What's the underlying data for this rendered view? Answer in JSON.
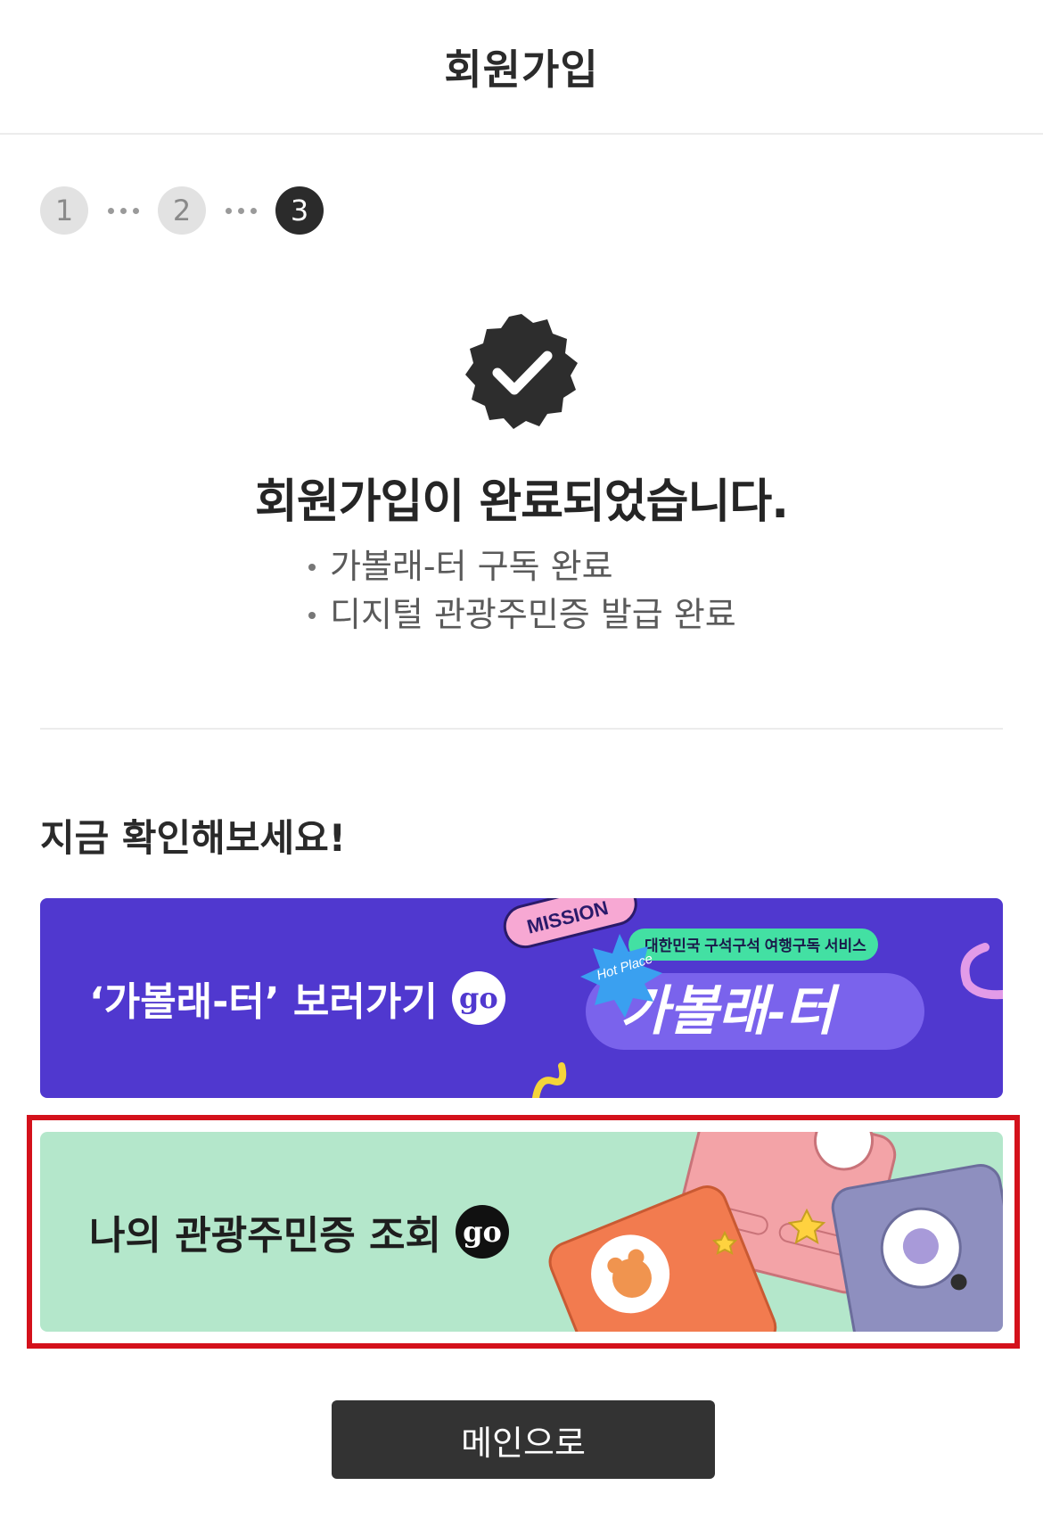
{
  "header": {
    "title": "회원가입"
  },
  "steps": {
    "items": [
      "1",
      "2",
      "3"
    ],
    "current_step": 3
  },
  "completion": {
    "title": "회원가입이 완료되었습니다.",
    "bullets": [
      "가볼래-터 구독 완료",
      "디지털 관광주민증 발급 완료"
    ],
    "icon": "verified-check-badge-icon"
  },
  "section": {
    "title": "지금 확인해보세요!"
  },
  "banners": [
    {
      "label": "‘가볼래-터’ 보러가기",
      "go": "go",
      "art": {
        "mission": "MISSION",
        "hot_place": "Hot Place",
        "tagline": "대한민국 구석구석 여행구독 서비스",
        "logo": "가볼래-터"
      }
    },
    {
      "label": "나의 관광주민증 조회",
      "go": "go"
    }
  ],
  "main_button": {
    "label": "메인으로"
  },
  "colors": {
    "banner_1_bg": "#5038cf",
    "banner_2_bg": "#b4e7cb",
    "highlight_border": "#d4111b",
    "button_bg": "#333333"
  }
}
